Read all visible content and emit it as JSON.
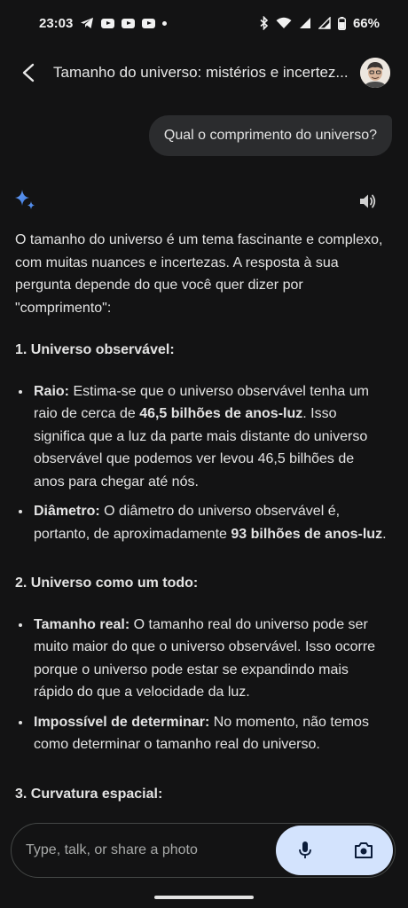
{
  "status": {
    "time": "23:03",
    "battery": "66%"
  },
  "header": {
    "title": "Tamanho do universo: mistérios e incertez..."
  },
  "user_message": "Qual o comprimento do universo?",
  "response": {
    "intro": "O tamanho do universo é um tema fascinante e complexo, com muitas nuances e incertezas. A resposta à sua pergunta depende do que você quer dizer por \"comprimento\":",
    "sections": [
      {
        "heading": "1. Universo observável:",
        "items": [
          {
            "parts": [
              {
                "t": "Raio:",
                "b": true
              },
              {
                "t": " Estima-se que o universo observável tenha um raio de cerca de ",
                "b": false
              },
              {
                "t": "46,5 bilhões de anos-luz",
                "b": true
              },
              {
                "t": ". Isso significa que a luz da parte mais distante do universo observável que podemos ver levou 46,5 bilhões de anos para chegar até nós.",
                "b": false
              }
            ]
          },
          {
            "parts": [
              {
                "t": "Diâmetro:",
                "b": true
              },
              {
                "t": " O diâmetro do universo observável é, portanto, de aproximadamente ",
                "b": false
              },
              {
                "t": "93 bilhões de anos-luz",
                "b": true
              },
              {
                "t": ".",
                "b": false
              }
            ]
          }
        ]
      },
      {
        "heading": "2. Universo como um todo:",
        "items": [
          {
            "parts": [
              {
                "t": "Tamanho real:",
                "b": true
              },
              {
                "t": " O tamanho real do universo pode ser muito maior do que o universo observável. Isso ocorre porque o universo pode estar se expandindo mais rápido do que a velocidade da luz.",
                "b": false
              }
            ]
          },
          {
            "parts": [
              {
                "t": "Impossível de determinar:",
                "b": true
              },
              {
                "t": " No momento, não temos como determinar o tamanho real do universo.",
                "b": false
              }
            ]
          }
        ]
      },
      {
        "heading": "3. Curvatura espacial:",
        "items": []
      }
    ]
  },
  "input": {
    "placeholder": "Type, talk, or share a photo"
  },
  "icons": {
    "back": "arrow-back-icon",
    "gemini": "gemini-sparkle-icon",
    "speaker": "speaker-icon",
    "mic": "mic-icon",
    "camera": "camera-icon"
  },
  "colors": {
    "background": "#131314",
    "bubble": "#2b2c2e",
    "accent": "#d3e3fd",
    "gemini_blue": "#4a90e2"
  }
}
